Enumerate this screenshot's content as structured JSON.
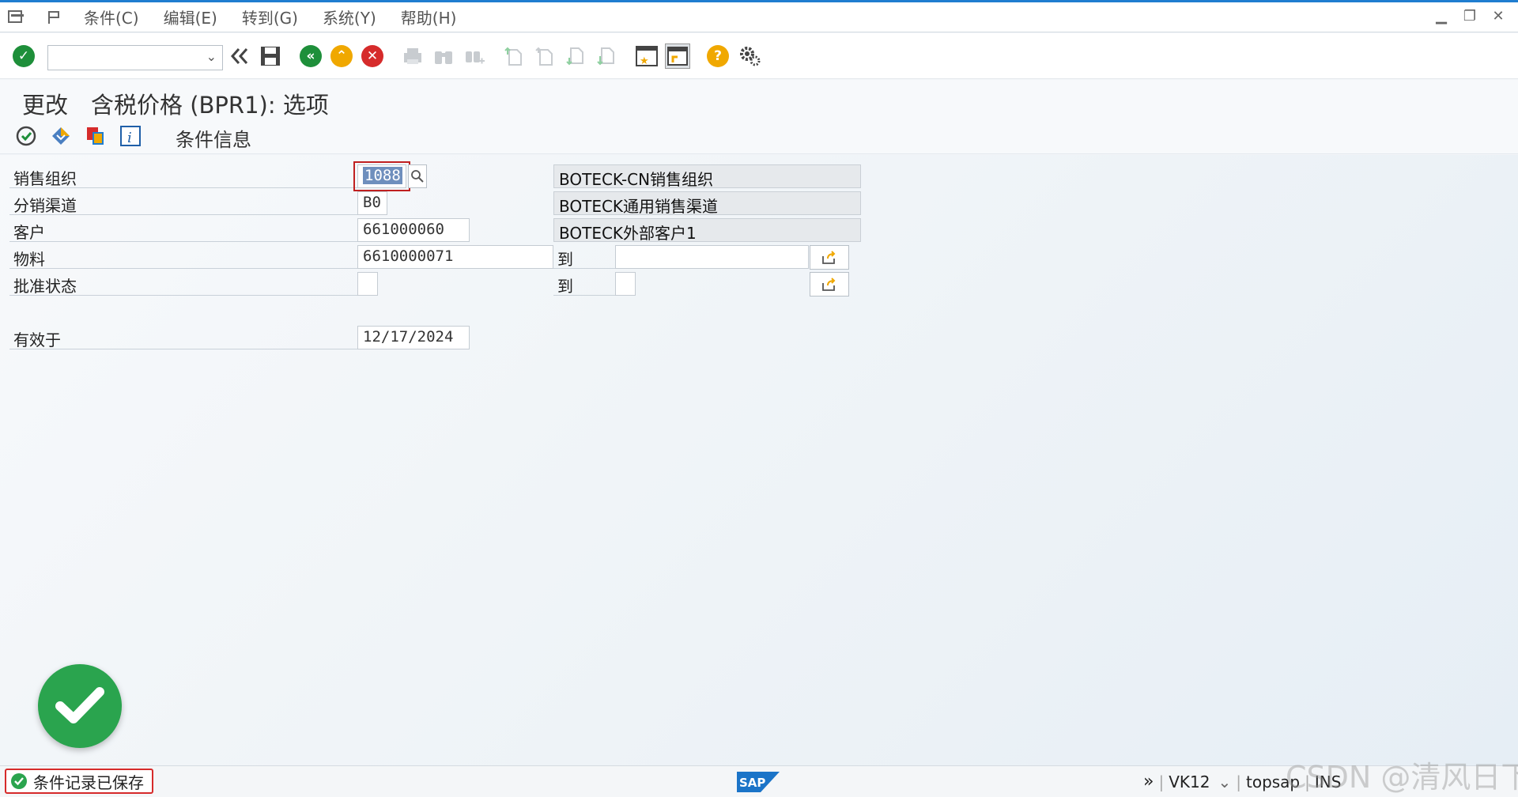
{
  "menubar": {
    "items": [
      "条件(C)",
      "编辑(E)",
      "转到(G)",
      "系统(Y)",
      "帮助(H)"
    ]
  },
  "toolbar": {
    "command_value": ""
  },
  "title": {
    "text": "更改　含税价格 (BPR1): 选项"
  },
  "app_toolbar": {
    "condition_info_label": "条件信息"
  },
  "form": {
    "sales_org": {
      "label": "销售组织",
      "value": "1088",
      "description": "BOTECK-CN销售组织"
    },
    "dist_channel": {
      "label": "分销渠道",
      "value": "B0",
      "description": "BOTECK通用销售渠道"
    },
    "customer": {
      "label": "客户",
      "value": "661000060",
      "description": "BOTECK外部客户1"
    },
    "material": {
      "label": "物料",
      "value": "6610000071",
      "to_label": "到",
      "to_value": ""
    },
    "approval_status": {
      "label": "批准状态",
      "value": "",
      "to_label": "到",
      "to_value": ""
    },
    "valid_on": {
      "label": "有效于",
      "value": "12/17/2024"
    }
  },
  "status_bar": {
    "message": "条件记录已保存",
    "transaction": "VK12",
    "system": "topsap",
    "mode": "INS",
    "logo": "SAP"
  },
  "watermark": "CSDN @清风日下",
  "colors": {
    "accent_blue": "#1f7dd0",
    "success_green": "#2aa44e",
    "error_red": "#d62b2b",
    "nav_green": "#1e8f3a",
    "warning_orange": "#f0a800"
  }
}
